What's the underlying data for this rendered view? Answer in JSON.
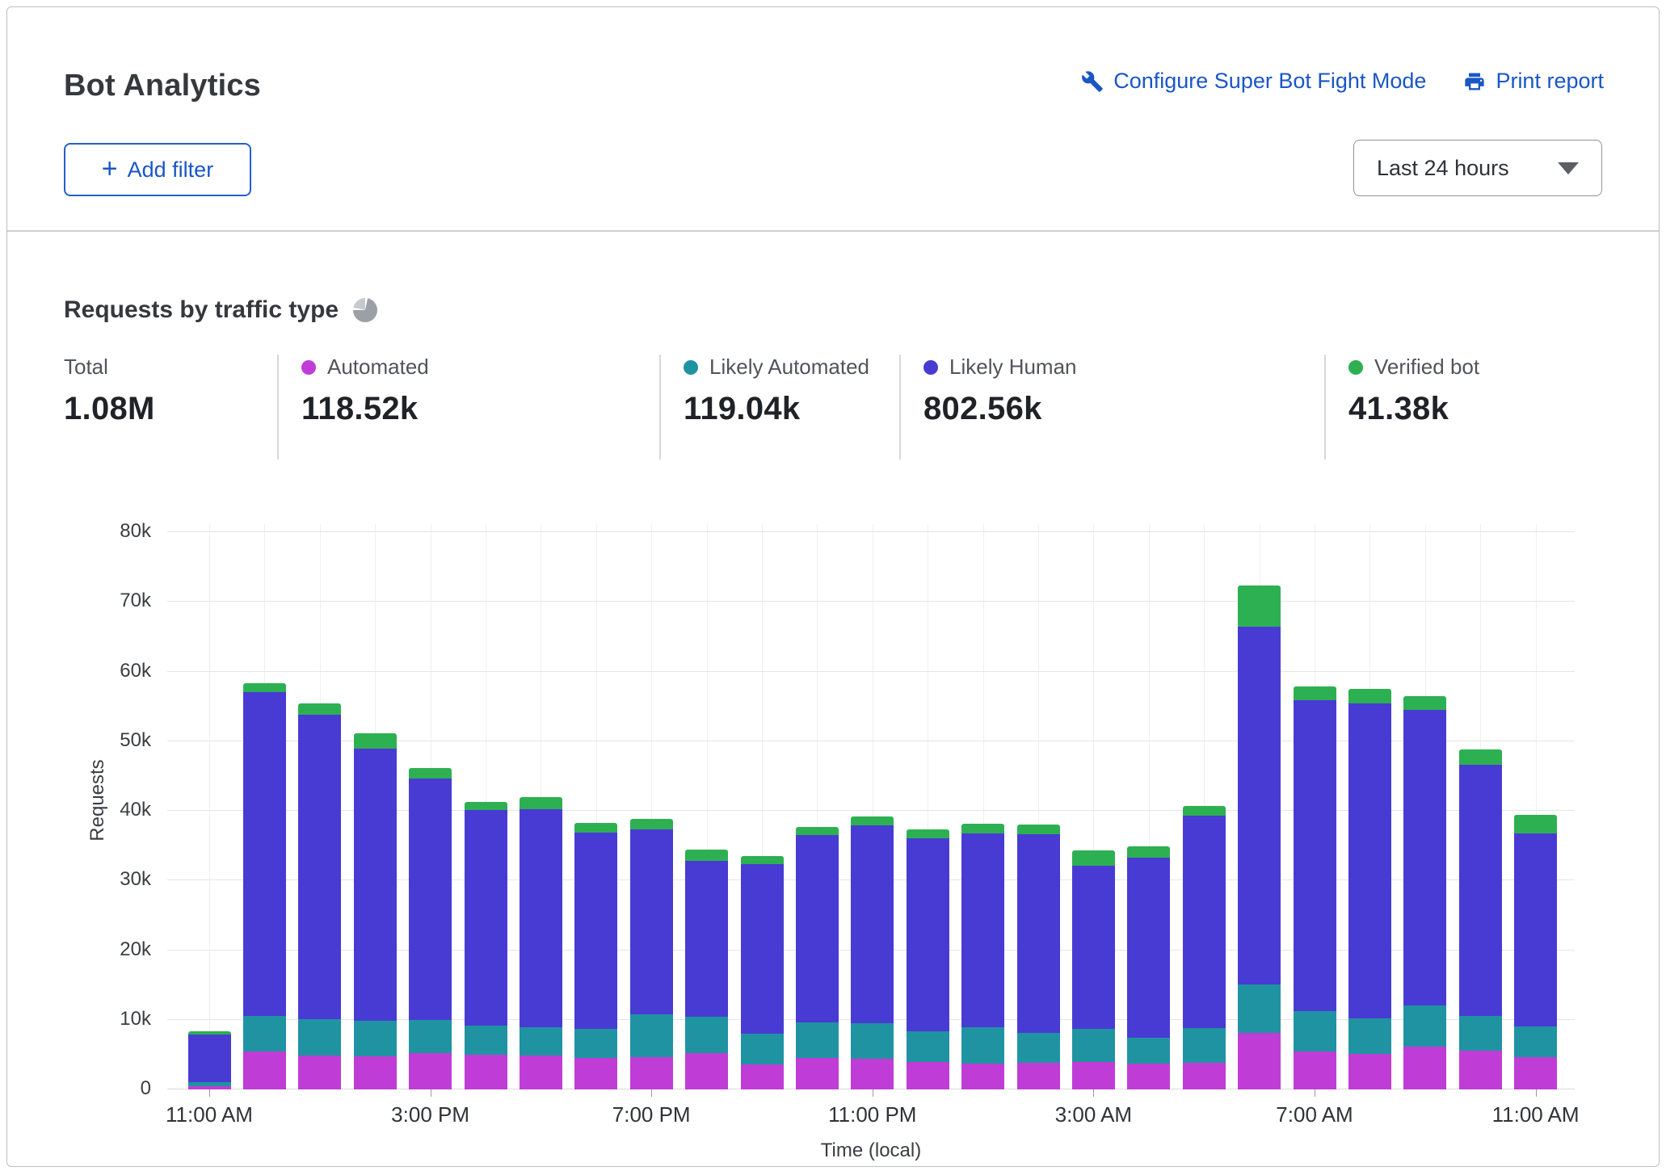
{
  "header": {
    "title": "Bot Analytics",
    "configure_label": "Configure Super Bot Fight Mode",
    "print_label": "Print report"
  },
  "filters": {
    "add_filter_label": "Add filter",
    "time_range_value": "Last 24 hours"
  },
  "section": {
    "heading": "Requests by traffic type"
  },
  "stats": [
    {
      "label": "Total",
      "value": "1.08M",
      "color": ""
    },
    {
      "label": "Automated",
      "value": "118.52k",
      "color": "#bf3dd6"
    },
    {
      "label": "Likely Automated",
      "value": "119.04k",
      "color": "#2093a2"
    },
    {
      "label": "Likely Human",
      "value": "802.56k",
      "color": "#483bd3"
    },
    {
      "label": "Verified bot",
      "value": "41.38k",
      "color": "#2db052"
    }
  ],
  "chart_data": {
    "type": "bar",
    "stacked": true,
    "title": "Requests by traffic type",
    "xlabel": "Time (local)",
    "ylabel": "Requests",
    "ylim": [
      0,
      80000
    ],
    "ytick_step": 10000,
    "ytick_labels": [
      "0",
      "10k",
      "20k",
      "30k",
      "40k",
      "50k",
      "60k",
      "70k",
      "80k"
    ],
    "grid": true,
    "categories": [
      "11:00 AM",
      "12:00 PM",
      "1:00 PM",
      "2:00 PM",
      "3:00 PM",
      "4:00 PM",
      "5:00 PM",
      "6:00 PM",
      "7:00 PM",
      "8:00 PM",
      "9:00 PM",
      "10:00 PM",
      "11:00 PM",
      "12:00 AM",
      "1:00 AM",
      "2:00 AM",
      "3:00 AM",
      "4:00 AM",
      "5:00 AM",
      "6:00 AM",
      "7:00 AM",
      "8:00 AM",
      "9:00 AM",
      "10:00 AM",
      "11:00 AM"
    ],
    "xtick_label_every": 4,
    "series": [
      {
        "name": "Automated",
        "color": "#bf3dd6",
        "values": [
          500,
          5500,
          4900,
          4700,
          5200,
          5000,
          4900,
          4500,
          4600,
          5200,
          3600,
          4500,
          4400,
          3900,
          3700,
          3800,
          3900,
          3700,
          3800,
          8100,
          5500,
          5100,
          6100,
          5600,
          4600
        ]
      },
      {
        "name": "Likely Automated",
        "color": "#2093a2",
        "values": [
          600,
          5000,
          5200,
          5100,
          4800,
          4200,
          4000,
          4200,
          6200,
          5200,
          4400,
          5100,
          5100,
          4400,
          5200,
          4300,
          4800,
          3700,
          5000,
          7000,
          5800,
          5100,
          6000,
          4900,
          4500
        ]
      },
      {
        "name": "Likely Human",
        "color": "#483bd3",
        "values": [
          6800,
          46500,
          43700,
          39100,
          34600,
          30900,
          31300,
          28200,
          26500,
          22400,
          24400,
          26900,
          28400,
          27800,
          27800,
          28500,
          23400,
          25900,
          30500,
          51300,
          44600,
          45200,
          42400,
          36100,
          27600
        ]
      },
      {
        "name": "Verified bot",
        "color": "#2db052",
        "values": [
          400,
          1300,
          1600,
          2200,
          1600,
          1200,
          1800,
          1400,
          1500,
          1600,
          1100,
          1200,
          1300,
          1200,
          1500,
          1400,
          2200,
          1600,
          1400,
          5900,
          2000,
          2100,
          2000,
          2200,
          2700
        ]
      }
    ]
  }
}
